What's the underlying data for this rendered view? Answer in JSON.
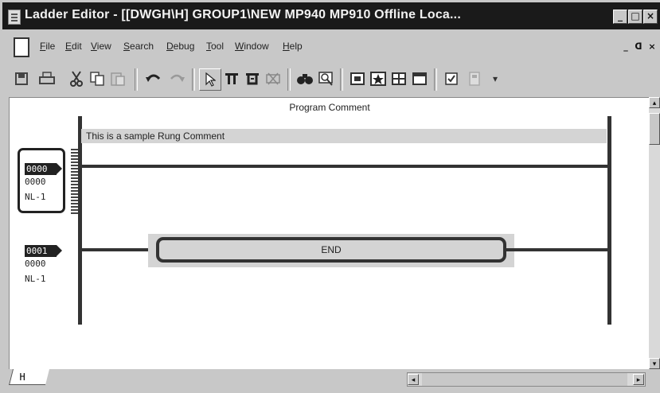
{
  "window": {
    "title": "Ladder Editor - [[DWGH\\H]    GROUP1\\NEW  MP940  MP910    Offline  Loca...",
    "minimize": "_",
    "maximize": "□",
    "close": "×"
  },
  "menu": {
    "items": [
      "File",
      "Edit",
      "View",
      "Search",
      "Debug",
      "Tool",
      "Window",
      "Help"
    ],
    "mdi_minimize": "_",
    "mdi_restore": "ᗡ",
    "mdi_close": "×"
  },
  "toolbar": {
    "icons": [
      "save-icon",
      "print-icon",
      "cut-icon",
      "copy-icon",
      "paste-icon",
      "undo-icon",
      "redo-icon",
      "pointer-icon",
      "contact-icon",
      "coil-icon",
      "delete-element-icon",
      "find-icon",
      "zoom-icon",
      "register-icon",
      "star-icon",
      "grid-icon",
      "window-icon",
      "checkbox-icon",
      "disabled-icon"
    ],
    "more": "▾"
  },
  "editor": {
    "program_comment": "Program Comment",
    "rung_comment": "This is a sample Rung Comment",
    "rungs": [
      {
        "number": "0000",
        "step": "0000",
        "label": "NL-1"
      },
      {
        "number": "0001",
        "step": "0000",
        "label": "NL-1"
      }
    ],
    "end_label": "END"
  },
  "status": {
    "sheet_tab": "H",
    "scroll_left": "◂",
    "scroll_right": "▸",
    "scroll_up": "▴",
    "scroll_down": "▾"
  }
}
